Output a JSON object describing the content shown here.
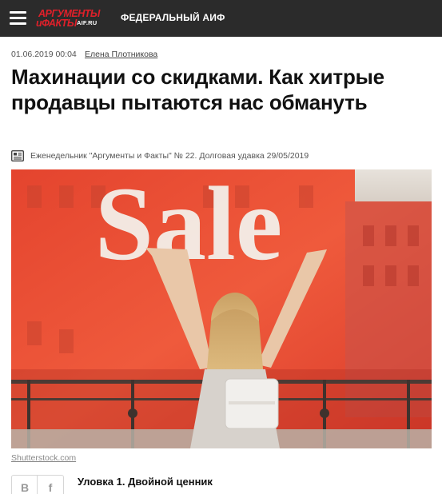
{
  "header": {
    "logo_line1": "АРГУМЕНТЫ",
    "logo_line2": "иФАКТЫ",
    "logo_domain": "AIF.RU",
    "section": "ФЕДЕРАЛЬНЫЙ АИФ",
    "brand_color": "#e0202a",
    "bar_color": "#2b2b2b"
  },
  "article": {
    "date": "01.06.2019 00:04",
    "author": "Елена Плотникова",
    "title": "Махинации со скидками. Как хитрые продавцы пытаются нас обмануть",
    "issue": "Еженедельник \"Аргументы и Факты\" № 22. Долговая удавка 29/05/2019",
    "photo_sign_text": "Sale",
    "photo_credit": "Shutterstock.com",
    "first_subheading": "Уловка 1. Двойной ценник"
  },
  "share": {
    "vk_label": "В",
    "fb_label": "f"
  },
  "icons": {
    "menu": "hamburger-menu-icon",
    "issue": "newspaper-icon",
    "vk": "vk-icon",
    "fb": "facebook-icon"
  }
}
